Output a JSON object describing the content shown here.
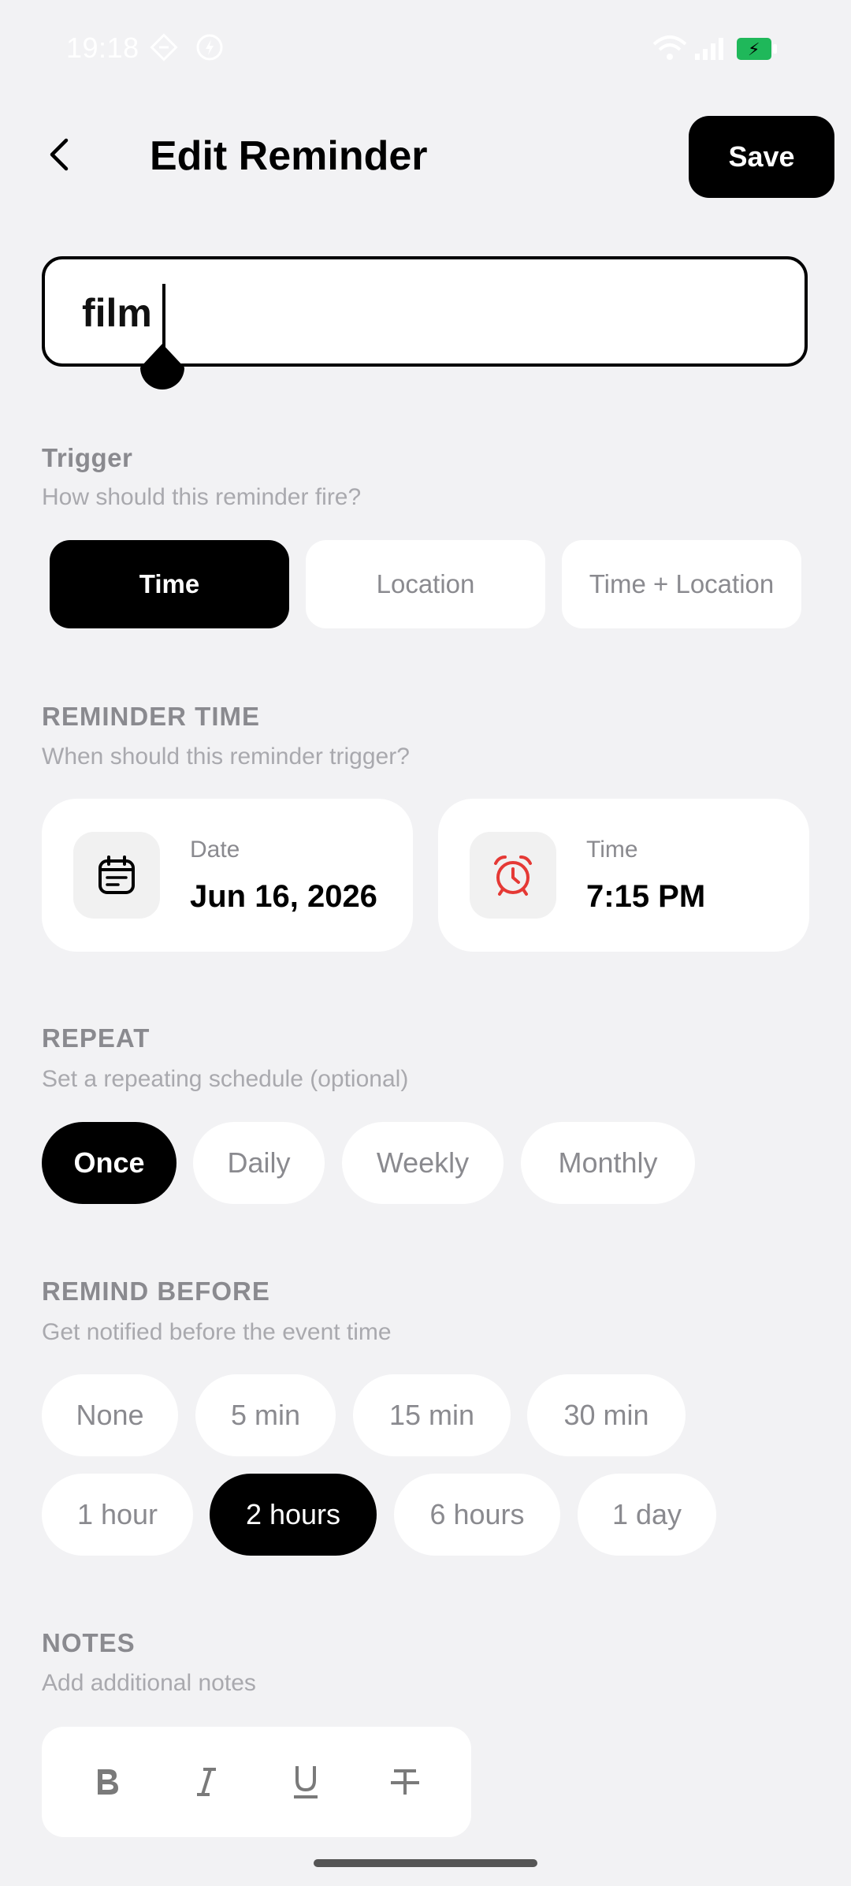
{
  "status_bar": {
    "time": "19:18"
  },
  "header": {
    "title": "Edit Reminder",
    "save_label": "Save"
  },
  "title_input": {
    "value": "film"
  },
  "trigger": {
    "label": "Trigger",
    "subtitle": "How should this reminder fire?",
    "options": [
      "Time",
      "Location",
      "Time + Location"
    ],
    "selected": "Time"
  },
  "reminder_time": {
    "label": "REMINDER TIME",
    "subtitle": "When should this reminder trigger?",
    "date_label": "Date",
    "date_value": "Jun 16, 2026",
    "time_label": "Time",
    "time_value": "7:15 PM"
  },
  "repeat": {
    "label": "REPEAT",
    "subtitle": "Set a repeating schedule (optional)",
    "options": [
      "Once",
      "Daily",
      "Weekly",
      "Monthly"
    ],
    "selected": "Once"
  },
  "remind_before": {
    "label": "REMIND BEFORE",
    "subtitle": "Get notified before the event time",
    "options": [
      "None",
      "5 min",
      "15 min",
      "30 min",
      "1 hour",
      "2 hours",
      "6 hours",
      "1 day"
    ],
    "selected": "2 hours"
  },
  "notes": {
    "label": "NOTES",
    "subtitle": "Add additional notes",
    "toolbar_icons": [
      "bold-icon",
      "italic-icon",
      "underline-icon",
      "strikethrough-icon"
    ]
  },
  "colors": {
    "accent": "#000000",
    "alarm_icon": "#e53935",
    "battery": "#1fb85a",
    "muted_text": "#8a8a8f"
  }
}
